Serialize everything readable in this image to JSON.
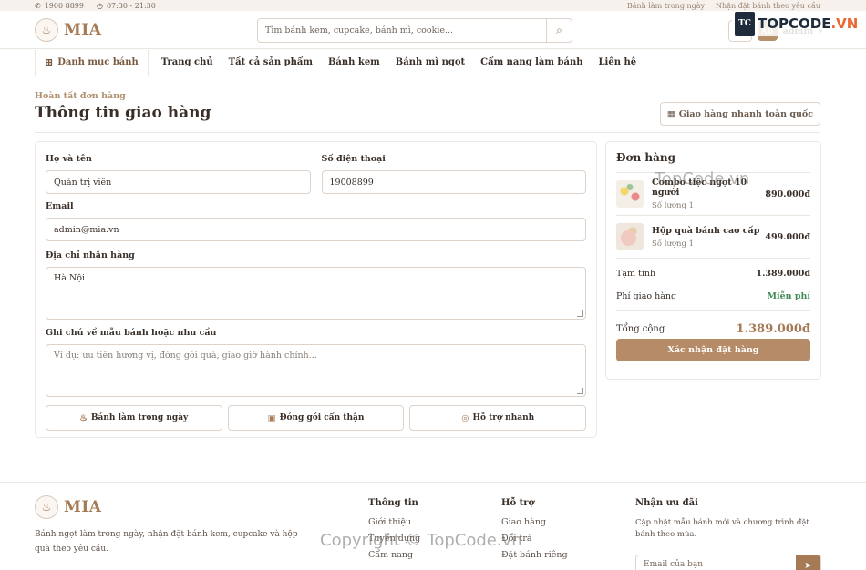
{
  "topbar": {
    "phone": "1900 8899",
    "hours": "07:30 - 21:30",
    "link_1": "Bánh làm trong ngày",
    "link_2": "Nhận đặt bánh theo yêu cầu"
  },
  "header": {
    "brand": "MIA",
    "search_placeholder": "Tìm bánh kem, cupcake, bánh mì, cookie...",
    "avatar_initials": "AD",
    "username": "admin"
  },
  "nav": {
    "category_label": "Danh mục bánh",
    "items": [
      "Trang chủ",
      "Tất cả sản phẩm",
      "Bánh kem",
      "Bánh mì ngọt",
      "Cẩm nang làm bánh",
      "Liên hệ"
    ]
  },
  "page": {
    "eyebrow": "Hoàn tất đơn hàng",
    "title": "Thông tin giao hàng",
    "ship_tag": "Giao hàng nhanh toàn quốc"
  },
  "form": {
    "name_label": "Họ và tên",
    "name_value": "Quản trị viên",
    "phone_label": "Số điện thoại",
    "phone_value": "19008899",
    "email_label": "Email",
    "email_value": "admin@mia.vn",
    "address_label": "Địa chỉ nhận hàng",
    "address_value": "Hà Nội",
    "note_label": "Ghi chú về mẫu bánh hoặc nhu cầu",
    "note_placeholder": "Ví dụ: ưu tiên hương vị, đóng gói quà, giao giờ hành chính...",
    "features": [
      "Bánh làm trong ngày",
      "Đóng gói cẩn thận",
      "Hỗ trợ nhanh"
    ]
  },
  "order": {
    "title": "Đơn hàng",
    "items": [
      {
        "name": "Combo tiệc ngọt 10 người",
        "qty": "Số lượng 1",
        "price": "890.000đ"
      },
      {
        "name": "Hộp quà bánh cao cấp",
        "qty": "Số lượng 1",
        "price": "499.000đ"
      }
    ],
    "subtotal_label": "Tạm tính",
    "subtotal_value": "1.389.000đ",
    "shipping_label": "Phí giao hàng",
    "shipping_value": "Miễn phí",
    "total_label": "Tổng cộng",
    "total_value": "1.389.000đ",
    "confirm_label": "Xác nhận đặt hàng"
  },
  "footer": {
    "brand": "MIA",
    "description": "Bánh ngọt làm trong ngày, nhận đặt bánh kem, cupcake và hộp quà theo yêu cầu.",
    "col1_title": "Thông tin",
    "col1_links": [
      "Giới thiệu",
      "Tuyển dụng",
      "Cẩm nang"
    ],
    "col2_title": "Hỗ trợ",
    "col2_links": [
      "Giao hàng",
      "Đổi trả",
      "Đặt bánh riêng"
    ],
    "news_title": "Nhận ưu đãi",
    "news_text": "Cập nhật mẫu bánh mới và chương trình đặt bánh theo mùa.",
    "news_placeholder": "Email của bạn"
  },
  "watermark": {
    "logo_box": "TC",
    "logo_text_1": "TOPCODE",
    "logo_text_2": ".VN",
    "mid": "TopCode.vn",
    "bottom": "Copyright © TopCode.vn"
  }
}
